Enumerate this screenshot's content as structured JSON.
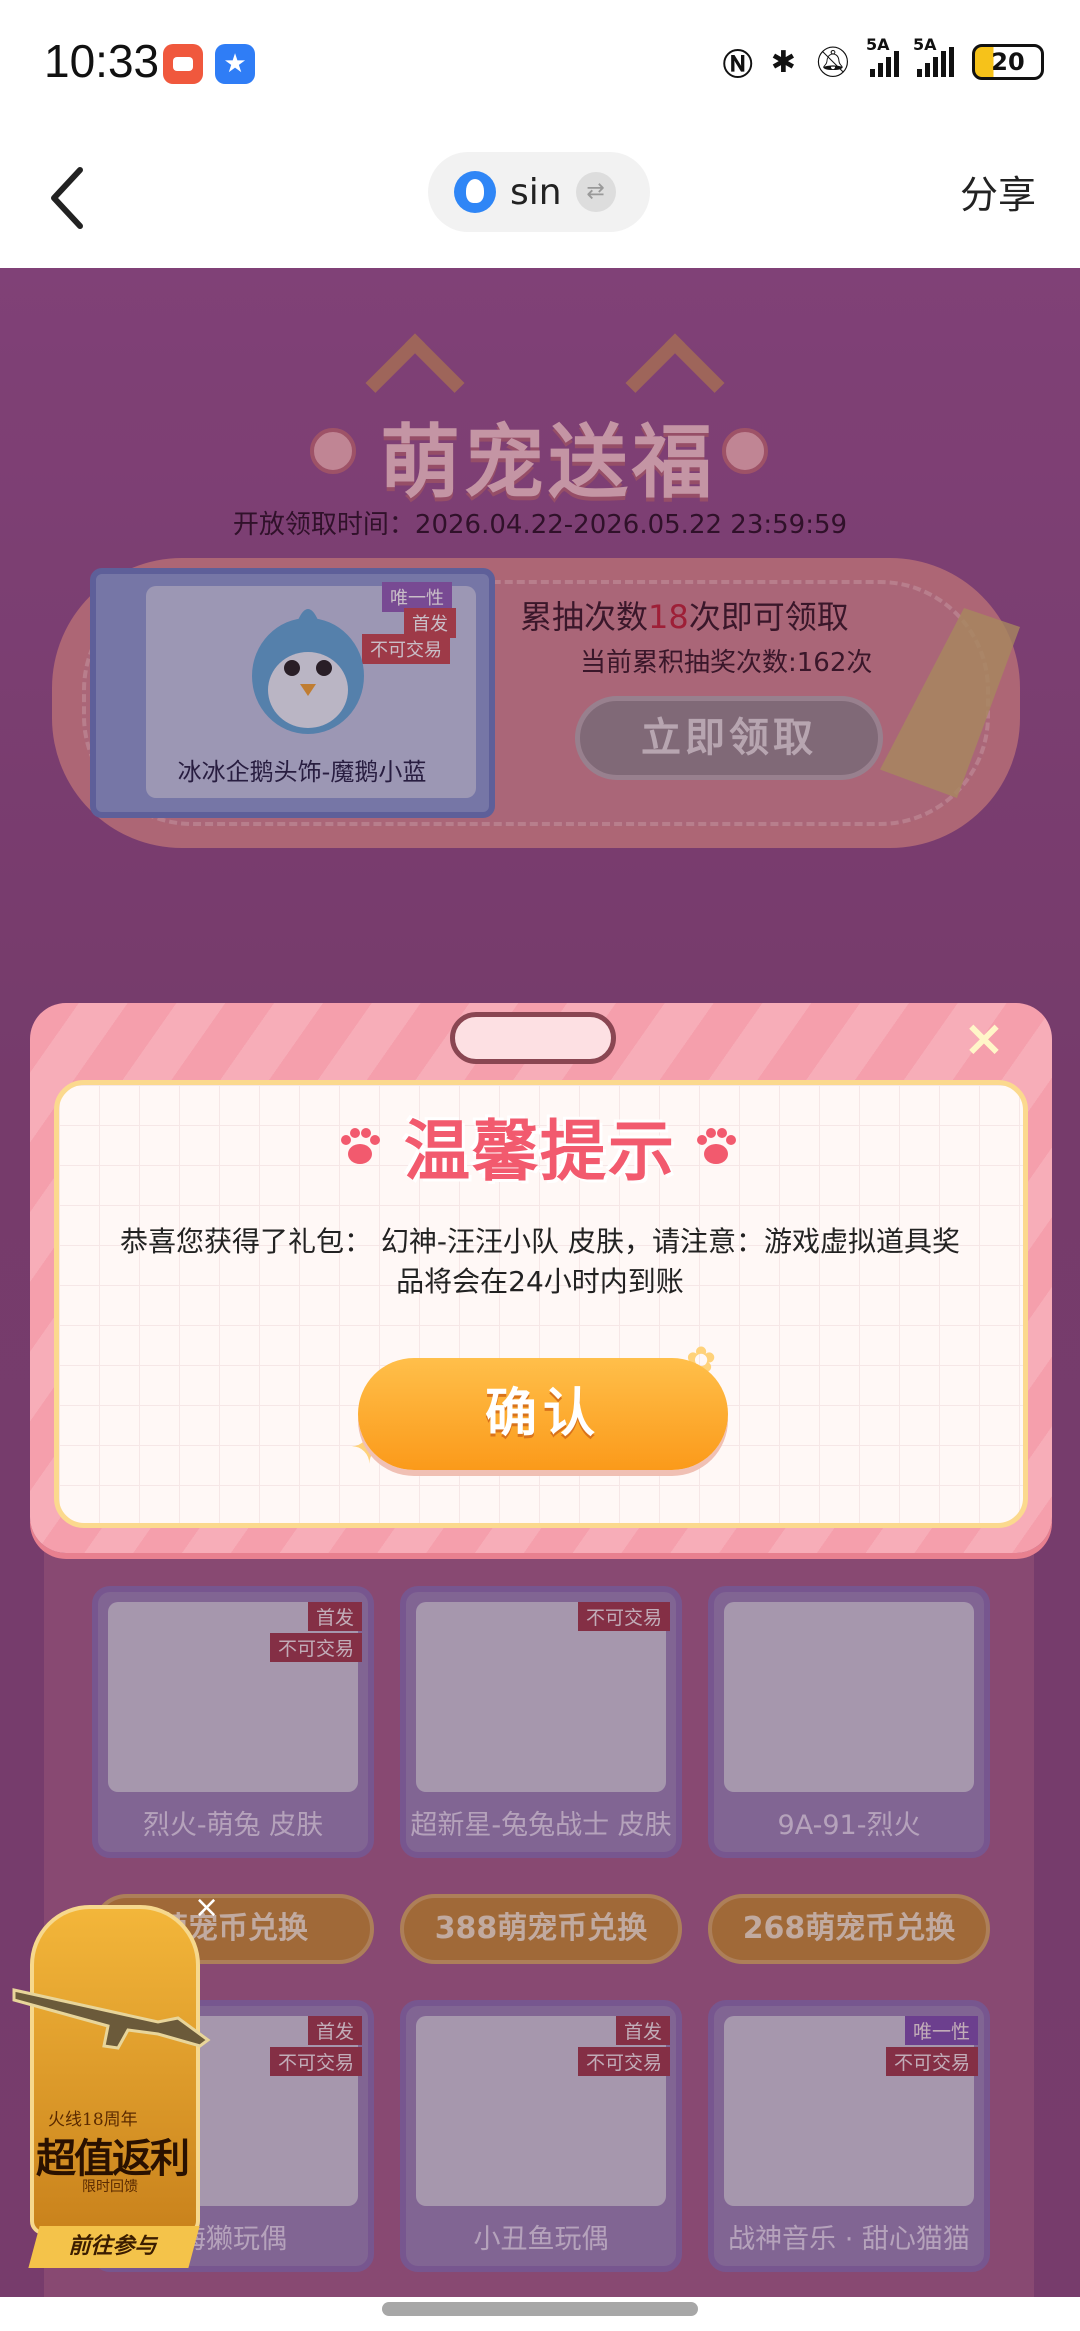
{
  "status_bar": {
    "time": "10:33",
    "signal_label_1": "5A",
    "signal_label_2": "5A",
    "battery": "20"
  },
  "nav": {
    "account_name": "sin",
    "share_label": "分享"
  },
  "event": {
    "title": "萌宠送福",
    "period": "开放领取时间：2026.04.22-2026.05.22 23:59:59",
    "reward": {
      "name": "冰冰企鹅头饰-魔鹅小蓝",
      "tags": [
        "唯一性",
        "首发",
        "不可交易"
      ],
      "requirement_prefix": "累抽次数",
      "requirement_number": "18",
      "requirement_suffix": "次即可领取",
      "current_count": "当前累积抽奖次数:162次",
      "claim_button": "立即领取"
    }
  },
  "items_row1": [
    {
      "label": "烈火-萌兔 皮肤",
      "tags": [
        "首发",
        "不可交易"
      ]
    },
    {
      "label": "超新星-兔兔战士 皮肤",
      "tags": [
        "不可交易"
      ]
    },
    {
      "label": "9A-91-烈火",
      "tags": []
    }
  ],
  "exchange_buttons": [
    "萌宠币兑换",
    "388萌宠币兑换",
    "268萌宠币兑换"
  ],
  "items_row2": [
    {
      "label": "海獭玩偶",
      "tags": [
        "首发",
        "不可交易"
      ]
    },
    {
      "label": "小丑鱼玩偶",
      "tags": [
        "首发",
        "不可交易"
      ]
    },
    {
      "label": "战神音乐 · 甜心猫猫",
      "tags": [
        "唯一性",
        "不可交易"
      ]
    }
  ],
  "promo": {
    "close": "×",
    "subtitle": "火线18周年",
    "title": "超值返利",
    "note": "限时回馈",
    "cta": "前往参与"
  },
  "modal": {
    "close": "×",
    "title": "温馨提示",
    "message_line1": "恭喜您获得了礼包：  幻神-汪汪小队 皮肤，请注意：游戏虚拟道具奖",
    "message_line2": "品将会在24小时内到账",
    "confirm": "确认"
  }
}
